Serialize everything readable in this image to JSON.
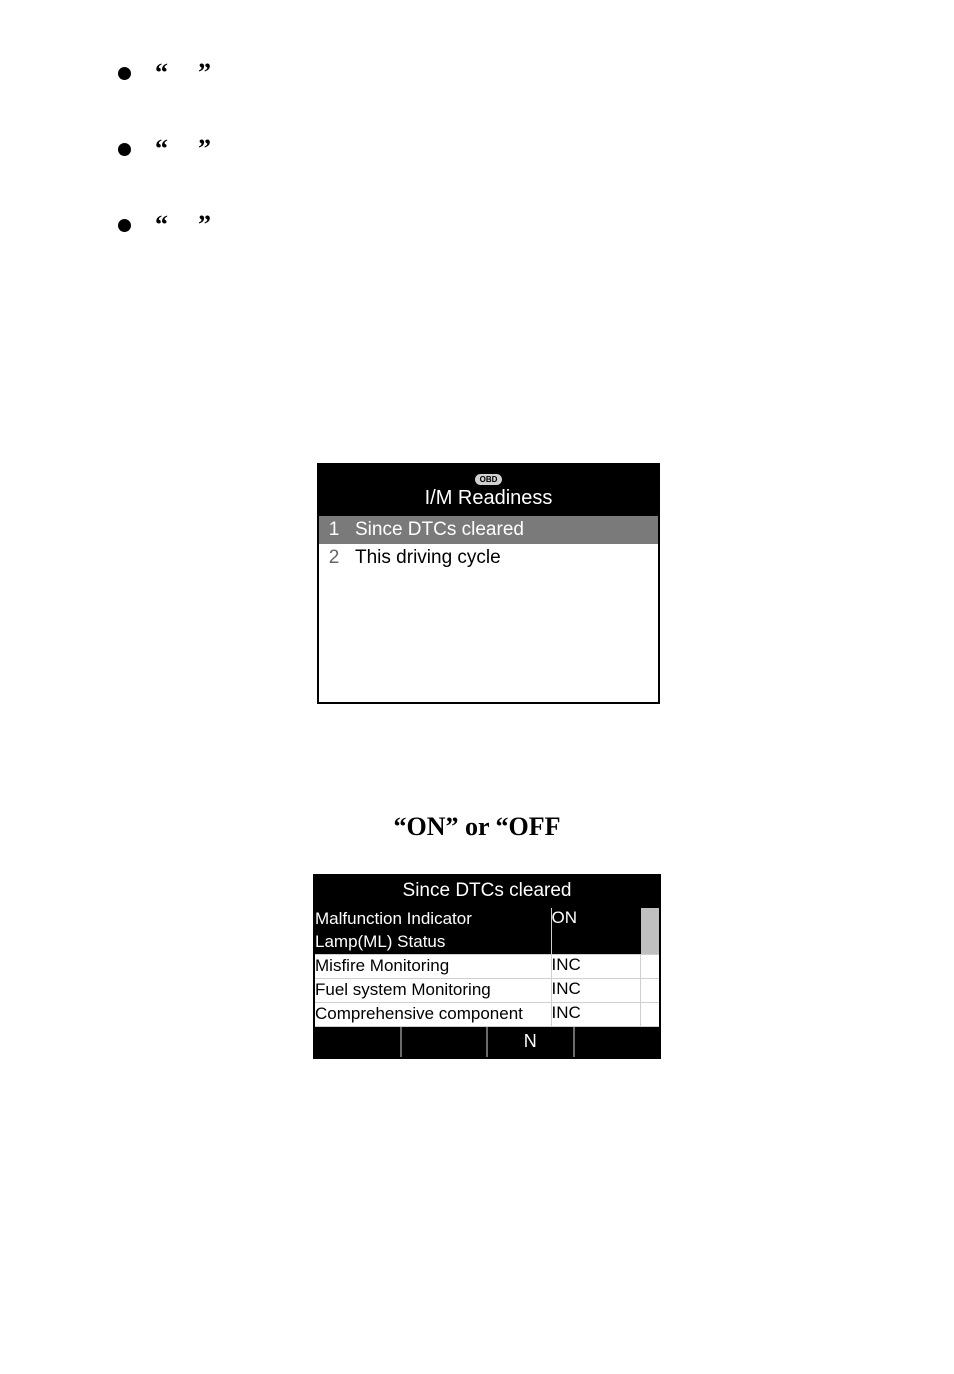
{
  "bullets": {
    "items": [
      {
        "left_quote": "“",
        "right_quote": "”"
      },
      {
        "left_quote": "“",
        "right_quote": "”"
      },
      {
        "left_quote": "“",
        "right_quote": "”"
      }
    ]
  },
  "screen1": {
    "obd_label": "OBD",
    "title": "I/M Readiness",
    "rows": [
      {
        "num": "1",
        "label": "Since DTCs cleared",
        "selected": true
      },
      {
        "num": "2",
        "label": "This driving cycle",
        "selected": false
      }
    ]
  },
  "midtext": "“ON” or “OFF",
  "screen2": {
    "title": "Since DTCs cleared",
    "rows": [
      {
        "label": "Malfunction Indicator Lamp(ML) Status",
        "value": "ON",
        "highlight": true
      },
      {
        "label": "Misfire Monitoring",
        "value": "INC",
        "highlight": false
      },
      {
        "label": "Fuel system Monitoring",
        "value": "INC",
        "highlight": false
      },
      {
        "label": "Comprehensive component",
        "value": "INC",
        "highlight": false
      }
    ],
    "footer": [
      "",
      "",
      "N",
      ""
    ]
  }
}
